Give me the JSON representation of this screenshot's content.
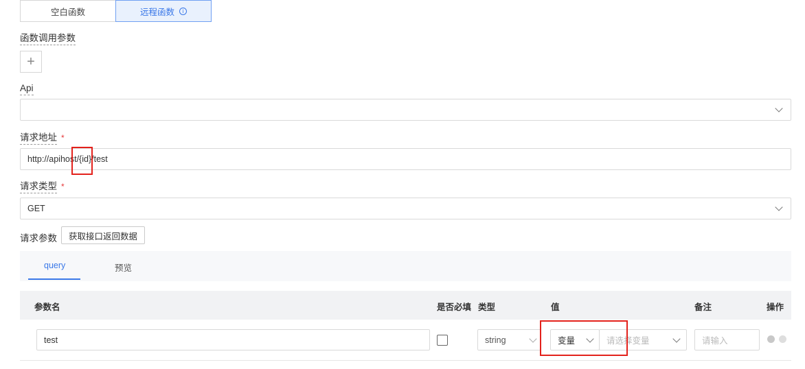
{
  "mode_toggle": {
    "blank_label": "空白函数",
    "remote_label": "远程函数",
    "info_glyph": "i"
  },
  "params_section": {
    "label": "函数调用参数",
    "add_glyph": "+"
  },
  "api": {
    "label": "Api",
    "value": ""
  },
  "request_url": {
    "label": "请求地址",
    "required_mark": "*",
    "value": "http://apihost/{id}/test"
  },
  "request_type": {
    "label": "请求类型",
    "required_mark": "*",
    "value": "GET"
  },
  "request_params": {
    "label": "请求参数",
    "fetch_button": "获取接口返回数据"
  },
  "tabs": [
    {
      "label": "query",
      "active": true
    },
    {
      "label": "预览",
      "active": false
    }
  ],
  "table": {
    "columns": [
      "参数名",
      "是否必填",
      "类型",
      "值",
      "备注",
      "操作"
    ],
    "rows": [
      {
        "name": "test",
        "required": false,
        "type": "string",
        "value_mode": "变量",
        "value_placeholder": "请选择变量",
        "remark_placeholder": "请输入"
      }
    ]
  },
  "colors": {
    "accent": "#3a78e8",
    "required": "#e6393a",
    "highlight": "#e3211b"
  },
  "icons": [
    "info-icon",
    "plus-icon",
    "chevron-down-icon",
    "add-row-icon",
    "remove-row-icon"
  ]
}
